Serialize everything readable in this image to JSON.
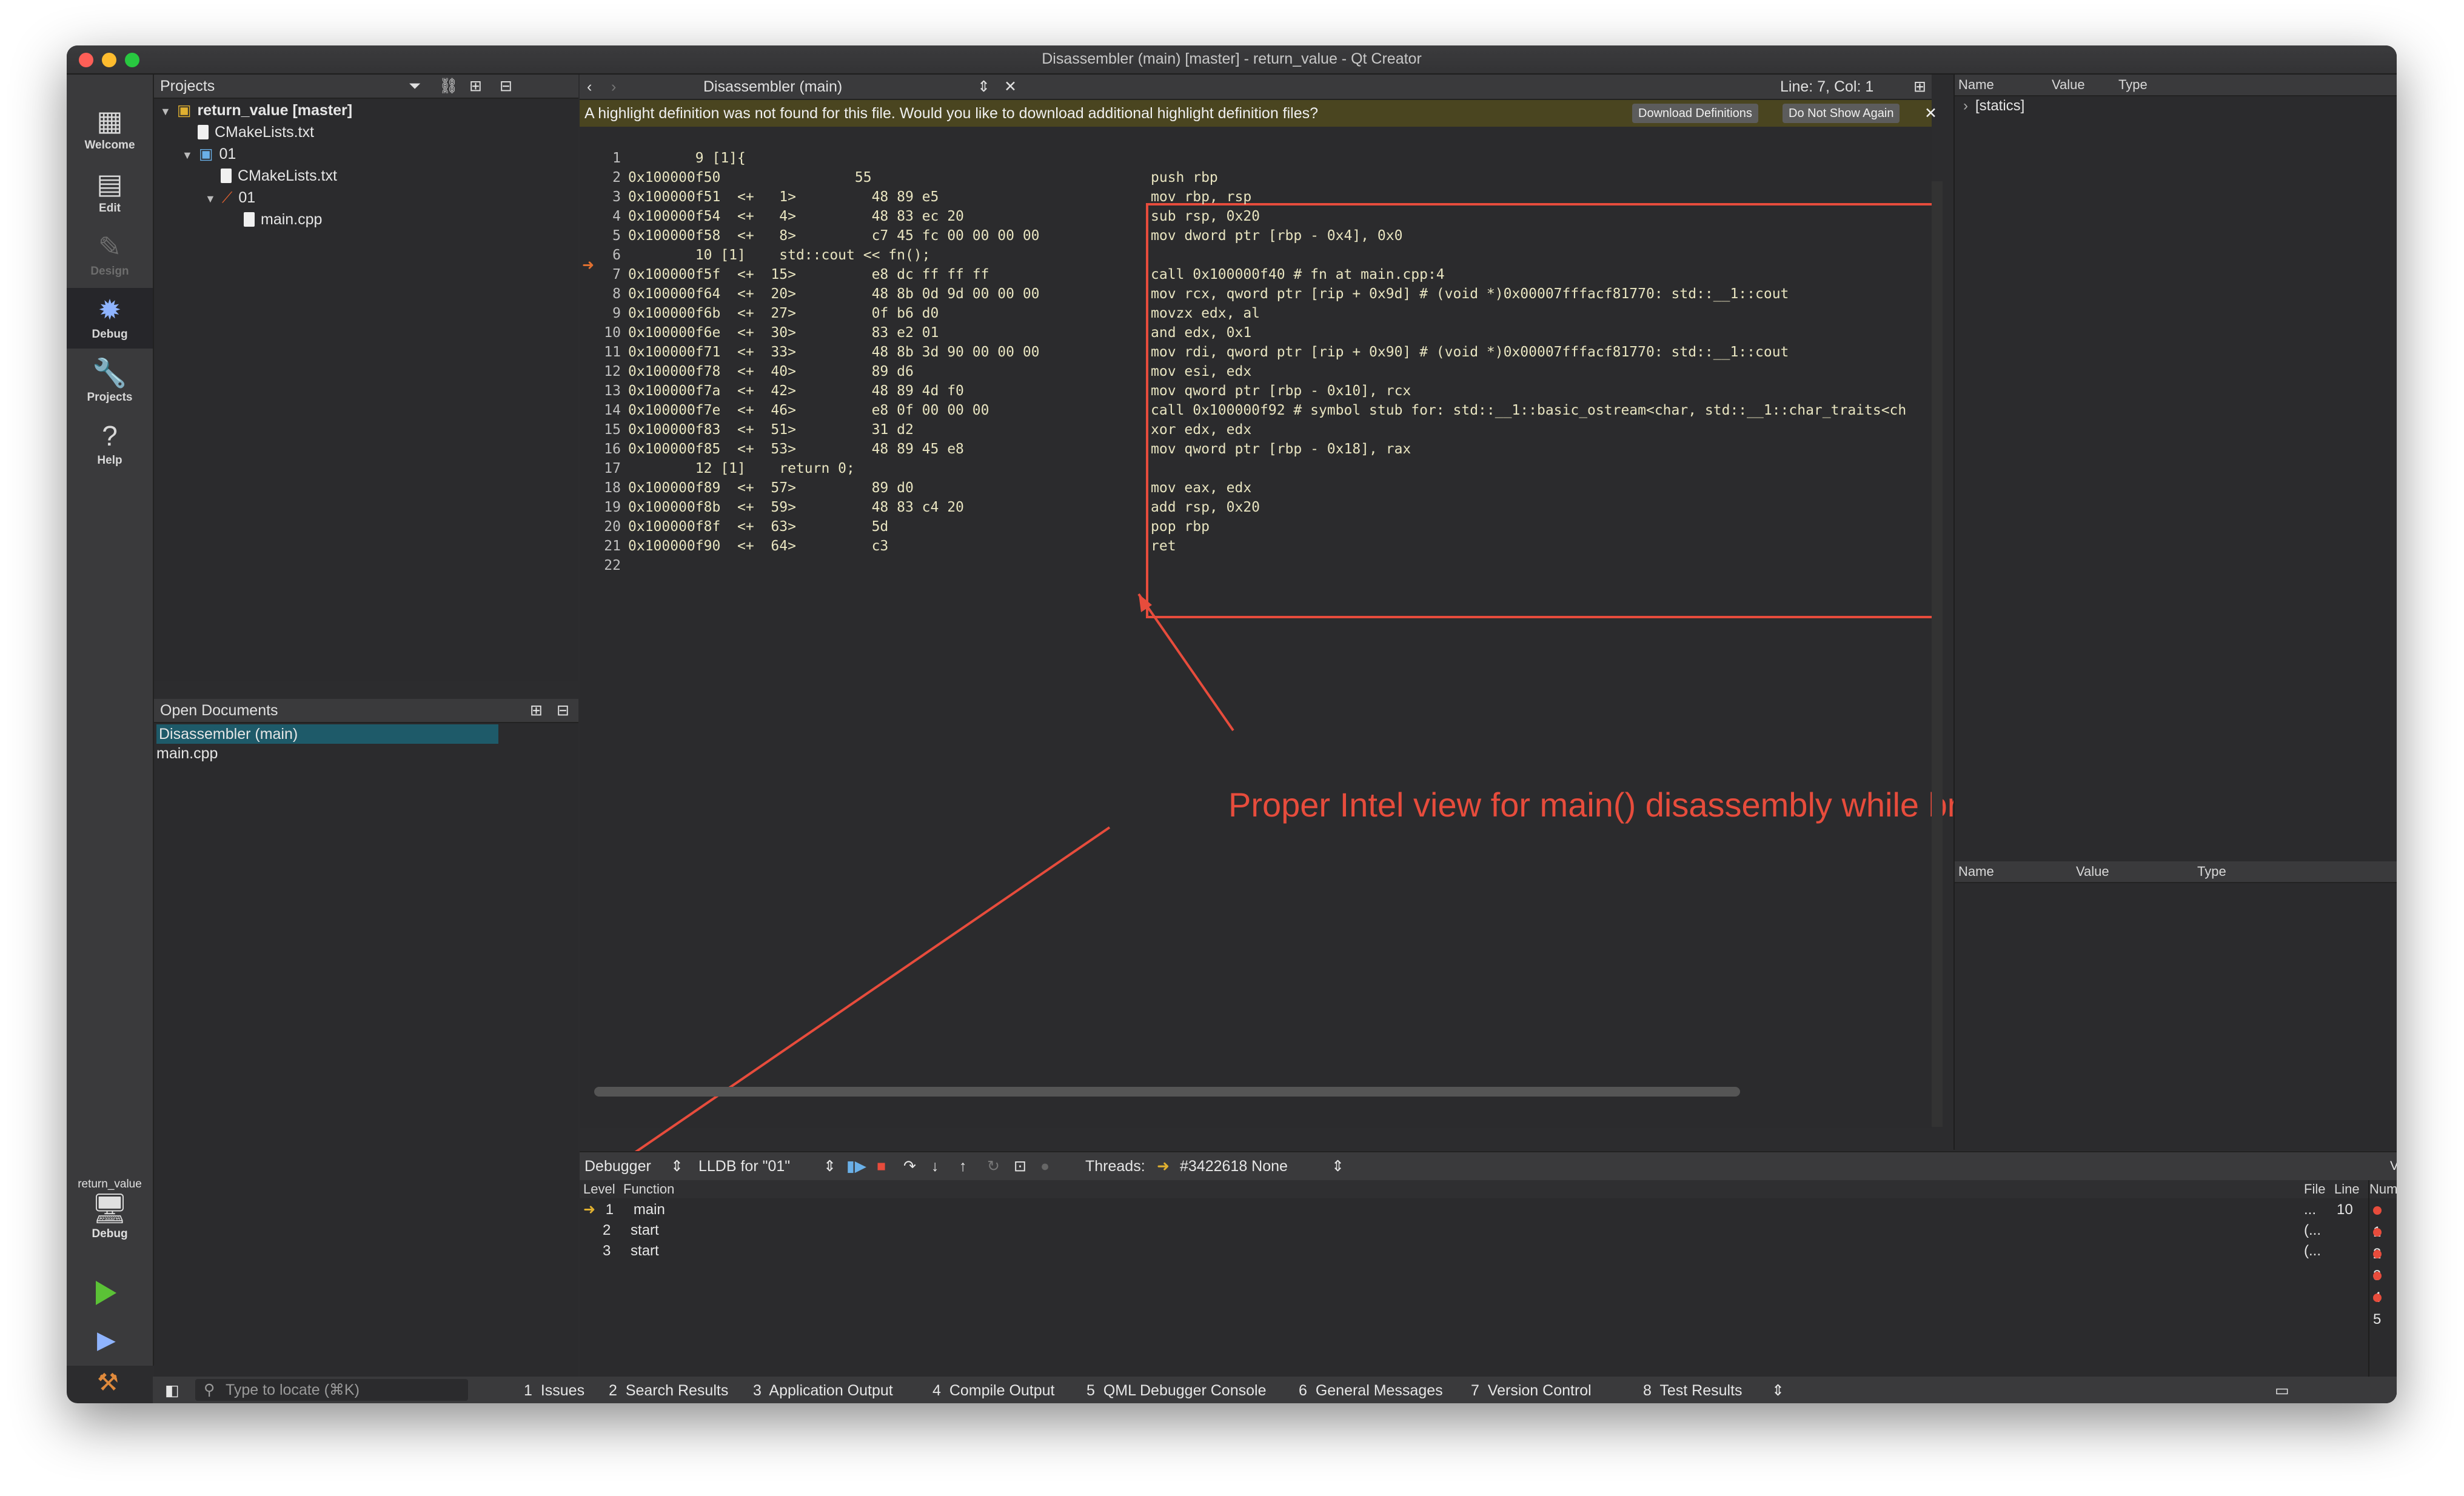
{
  "window": {
    "title": "Disassembler (main) [master] - return_value - Qt Creator"
  },
  "modes": [
    {
      "label": "Welcome",
      "icon": "welcome-icon"
    },
    {
      "label": "Edit",
      "icon": "edit-icon"
    },
    {
      "label": "Design",
      "icon": "design-icon"
    },
    {
      "label": "Debug",
      "icon": "debug-icon"
    },
    {
      "label": "Projects",
      "icon": "projects-icon"
    },
    {
      "label": "Help",
      "icon": "help-icon"
    }
  ],
  "kit": {
    "project": "return_value",
    "build": "Debug"
  },
  "projects": {
    "title": "Projects",
    "tree": [
      {
        "label": "return_value [master]"
      },
      {
        "label": "CMakeLists.txt"
      },
      {
        "label": "01"
      },
      {
        "label": "CMakeLists.txt"
      },
      {
        "label": "01"
      },
      {
        "label": "main.cpp"
      }
    ]
  },
  "open_documents": {
    "title": "Open Documents",
    "items": [
      "Disassembler (main)",
      "main.cpp"
    ]
  },
  "editor": {
    "tab": "Disassembler (main)",
    "position": "Line: 7, Col: 1",
    "info": "A highlight definition was not found for this file. Would you like to download additional highlight definition files?",
    "download_btn": "Download Definitions",
    "noshow_btn": "Do Not Show Again",
    "lines": [
      "        9 [1]{",
      "0x100000f50                55",
      "0x100000f51  <+   1>         48 89 e5",
      "0x100000f54  <+   4>         48 83 ec 20",
      "0x100000f58  <+   8>         c7 45 fc 00 00 00 00",
      "        10 [1]    std::cout << fn();",
      "0x100000f5f  <+  15>         e8 dc ff ff ff",
      "0x100000f64  <+  20>         48 8b 0d 9d 00 00 00",
      "0x100000f6b  <+  27>         0f b6 d0",
      "0x100000f6e  <+  30>         83 e2 01",
      "0x100000f71  <+  33>         48 8b 3d 90 00 00 00",
      "0x100000f78  <+  40>         89 d6",
      "0x100000f7a  <+  42>         48 89 4d f0",
      "0x100000f7e  <+  46>         e8 0f 00 00 00",
      "0x100000f83  <+  51>         31 d2",
      "0x100000f85  <+  53>         48 89 45 e8",
      "        12 [1]    return 0;",
      "0x100000f89  <+  57>         89 d0",
      "0x100000f8b  <+  59>         48 83 c4 20",
      "0x100000f8f  <+  63>         5d",
      "0x100000f90  <+  64>         c3",
      ""
    ],
    "line_numbers": [
      "1",
      "2",
      "3",
      "4",
      "5",
      "6",
      "7",
      "8",
      "9",
      "10",
      "11",
      "12",
      "13",
      "14",
      "15",
      "16",
      "17",
      "18",
      "19",
      "20",
      "21",
      "22"
    ],
    "asm": [
      "push rbp",
      "mov rbp, rsp",
      "sub rsp, 0x20",
      "mov dword ptr [rbp - 0x4], 0x0",
      "",
      "call 0x100000f40 # fn at main.cpp:4",
      "mov rcx, qword ptr [rip + 0x9d] # (void *)0x00007fffacf81770: std::__1::cout",
      "movzx edx, al",
      "and edx, 0x1",
      "mov rdi, qword ptr [rip + 0x90] # (void *)0x00007fffacf81770: std::__1::cout",
      "mov esi, edx",
      "mov qword ptr [rbp - 0x10], rcx",
      "call 0x100000f92 # symbol stub for: std::__1::basic_ostream<char, std::__1::char_traits<ch",
      "xor edx, edx",
      "mov qword ptr [rbp - 0x18], rax",
      "",
      "mov eax, edx",
      "add rsp, 0x20",
      "pop rbp",
      "ret"
    ]
  },
  "annotation": "Proper Intel view for main() disassembly while breakpoint in main()",
  "locals": {
    "col_name": "Name",
    "col_value": "Value",
    "col_type": "Type",
    "statics": "[statics]"
  },
  "expressions": {
    "col_name": "Name",
    "col_value": "Value",
    "col_type": "Type"
  },
  "debugger": {
    "mode": "Debugger",
    "engine": "LLDB for \"01\"",
    "threads_label": "Threads:",
    "thread": "#3422618 None",
    "views": "Views"
  },
  "stack": {
    "headers": {
      "level": "Level",
      "function": "Function",
      "file": "File",
      "line": "Line",
      "number": "Number"
    },
    "rows": [
      {
        "level": "1",
        "function": "main",
        "file": "...",
        "line": "10"
      },
      {
        "level": "2",
        "function": "start",
        "file": "(...",
        "line": ""
      },
      {
        "level": "3",
        "function": "start",
        "file": "(...",
        "line": ""
      }
    ],
    "breakpoints": [
      "1",
      "2",
      "3",
      "4",
      "5"
    ]
  },
  "status": {
    "locate_placeholder": "Type to locate (⌘K)",
    "tabs": [
      {
        "n": "1",
        "label": "Issues"
      },
      {
        "n": "2",
        "label": "Search Results"
      },
      {
        "n": "3",
        "label": "Application Output"
      },
      {
        "n": "4",
        "label": "Compile Output"
      },
      {
        "n": "5",
        "label": "QML Debugger Console"
      },
      {
        "n": "6",
        "label": "General Messages"
      },
      {
        "n": "7",
        "label": "Version Control"
      },
      {
        "n": "8",
        "label": "Test Results"
      }
    ]
  }
}
